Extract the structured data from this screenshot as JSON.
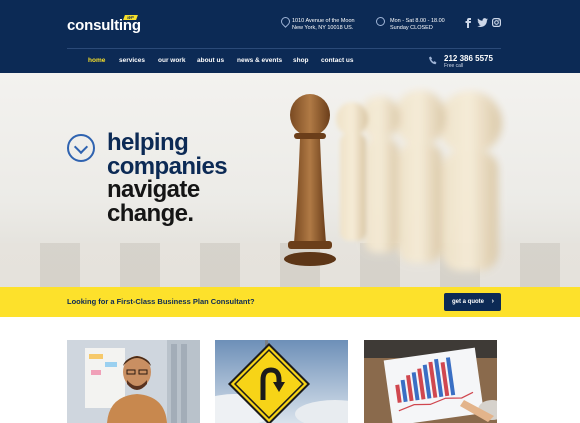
{
  "brand": {
    "logo_text": "consulting",
    "badge_text": "WP"
  },
  "header": {
    "address_line1": "1010 Avenue of the Moon",
    "address_line2": "New York, NY 10018 US.",
    "hours_line1": "Mon - Sat 8.00 - 18.00",
    "hours_line2": "Sunday CLOSED",
    "social": [
      "facebook-icon",
      "twitter-icon",
      "instagram-icon"
    ]
  },
  "nav": {
    "items": [
      {
        "label": "home",
        "active": true
      },
      {
        "label": "services",
        "active": false
      },
      {
        "label": "our work",
        "active": false
      },
      {
        "label": "about us",
        "active": false
      },
      {
        "label": "news & events",
        "active": false
      },
      {
        "label": "shop",
        "active": false
      },
      {
        "label": "contact us",
        "active": false
      }
    ],
    "phone": "212 386 5575",
    "phone_sub": "Free call"
  },
  "hero": {
    "line1": "helping",
    "line2": "companies",
    "line3": "navigate",
    "line4": "change."
  },
  "cta": {
    "text": "Looking for a First-Class Business Plan Consultant?",
    "button": "get a quote"
  },
  "colors": {
    "navy": "#0c2a55",
    "yellow": "#fde12b",
    "accent_blue": "#2f63b0"
  }
}
